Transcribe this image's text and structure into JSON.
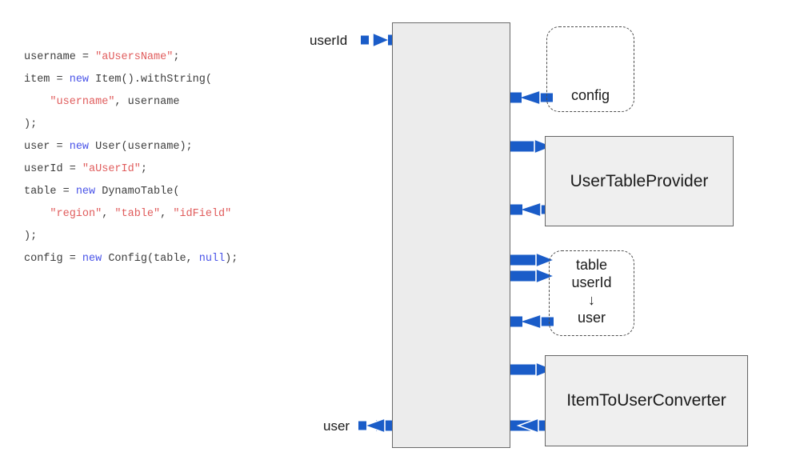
{
  "code": {
    "lines": [
      [
        {
          "t": "username = ",
          "k": "plain"
        },
        {
          "t": "\"aUsersName\"",
          "k": "string"
        },
        {
          "t": ";",
          "k": "plain"
        }
      ],
      [
        {
          "t": "item = ",
          "k": "plain"
        },
        {
          "t": "new",
          "k": "keyword"
        },
        {
          "t": " Item().withString(",
          "k": "plain"
        }
      ],
      [
        {
          "t": "    ",
          "k": "plain"
        },
        {
          "t": "\"username\"",
          "k": "string"
        },
        {
          "t": ", username",
          "k": "plain"
        }
      ],
      [
        {
          "t": ");",
          "k": "plain"
        }
      ],
      [
        {
          "t": "user = ",
          "k": "plain"
        },
        {
          "t": "new",
          "k": "keyword"
        },
        {
          "t": " User(username);",
          "k": "plain"
        }
      ],
      [
        {
          "t": "userId = ",
          "k": "plain"
        },
        {
          "t": "\"aUserId\"",
          "k": "string"
        },
        {
          "t": ";",
          "k": "plain"
        }
      ],
      [
        {
          "t": "table = ",
          "k": "plain"
        },
        {
          "t": "new",
          "k": "keyword"
        },
        {
          "t": " DynamoTable(",
          "k": "plain"
        }
      ],
      [
        {
          "t": "    ",
          "k": "plain"
        },
        {
          "t": "\"region\"",
          "k": "string"
        },
        {
          "t": ", ",
          "k": "plain"
        },
        {
          "t": "\"table\"",
          "k": "string"
        },
        {
          "t": ", ",
          "k": "plain"
        },
        {
          "t": "\"idField\"",
          "k": "string"
        }
      ],
      [
        {
          "t": ");",
          "k": "plain"
        }
      ],
      [
        {
          "t": "config = ",
          "k": "plain"
        },
        {
          "t": "new",
          "k": "keyword"
        },
        {
          "t": " Config(table, ",
          "k": "plain"
        },
        {
          "t": "null",
          "k": "keyword"
        },
        {
          "t": ");",
          "k": "plain"
        }
      ]
    ]
  },
  "diagram": {
    "colors": {
      "flow_blue": "#1a5cc8",
      "box_fill": "#efefef",
      "box_stroke": "#666666",
      "lifeline_fill": "#ececec",
      "lifeline_stroke": "#6b6b6b",
      "dashed_stroke": "#4d4d4d",
      "text": "#1a1a1a"
    },
    "input_label": "userId",
    "output_label": "user",
    "lifeline_name": "system-under-test-lifeline",
    "nodes": [
      {
        "id": "config",
        "style": "dashed",
        "label": "config"
      },
      {
        "id": "user-table-provider",
        "style": "solid",
        "label": "UserTableProvider"
      },
      {
        "id": "table-userid-user",
        "style": "dashed",
        "lines": [
          "table",
          "userId",
          "↓",
          "user"
        ]
      },
      {
        "id": "item-to-user-converter",
        "style": "solid",
        "label": "ItemToUserConverter"
      }
    ]
  }
}
